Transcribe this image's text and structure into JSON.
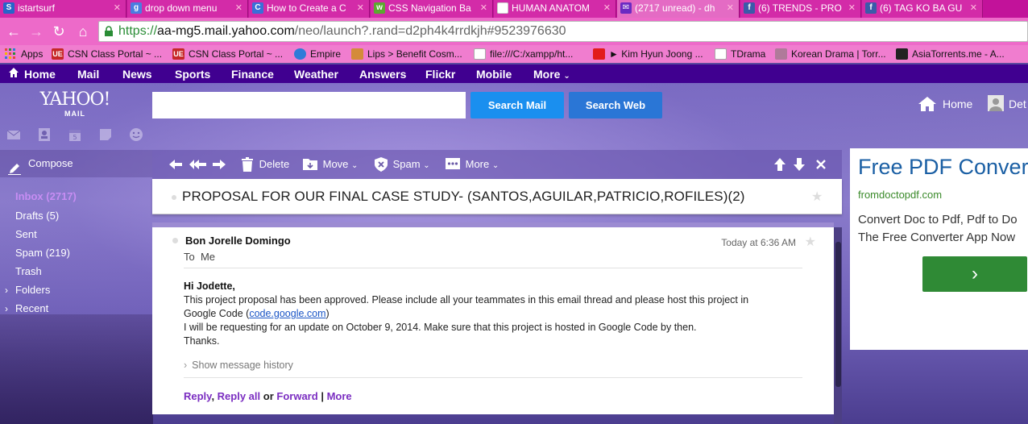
{
  "browser": {
    "tabs": [
      {
        "label": "istartsurf",
        "favicon": "S",
        "color": "#2766c9"
      },
      {
        "label": "drop down menu",
        "favicon": "g",
        "color": "#4a7de0"
      },
      {
        "label": "How to Create a C",
        "favicon": "C",
        "color": "#3a6fd8"
      },
      {
        "label": "CSS Navigation Ba",
        "favicon": "w",
        "color": "#5ca830"
      },
      {
        "label": "HUMAN ANATOM",
        "favicon": "",
        "color": "#ffffff"
      },
      {
        "label": "(2717 unread) - dh",
        "favicon": "",
        "color": "#6b2ac2"
      },
      {
        "label": "(6) TRENDS - PRO",
        "favicon": "f",
        "color": "#3b5ba9"
      },
      {
        "label": "(6) TAG KO BA GU",
        "favicon": "f",
        "color": "#3b5ba9"
      }
    ],
    "url": {
      "scheme": "https://",
      "host": "aa-mg5.mail.yahoo.com",
      "path": "/neo/launch?.rand=d2ph4k4rrdkjh#9523976630"
    },
    "bookmarks": [
      {
        "label": "Apps",
        "color": "#e04a3a"
      },
      {
        "label": "CSN Class Portal ~ ...",
        "color": "#c62828"
      },
      {
        "label": "CSN Class Portal ~ ...",
        "color": "#c62828"
      },
      {
        "label": "Empire",
        "color": "#2f7bd8"
      },
      {
        "label": "Lips > Benefit Cosm...",
        "color": "#d48b3a"
      },
      {
        "label": "file:///C:/xampp/ht...",
        "color": "#ffffff"
      },
      {
        "label": "► Kim Hyun Joong ...",
        "color": "#e21b1b"
      },
      {
        "label": "TDrama",
        "color": "#ffffff"
      },
      {
        "label": "Korean Drama | Torr...",
        "color": "#b07a9a"
      },
      {
        "label": "AsiaTorrents.me - A...",
        "color": "#222222"
      }
    ]
  },
  "ynav": {
    "items": [
      "Home",
      "Mail",
      "News",
      "Sports",
      "Finance",
      "Weather",
      "Answers",
      "Flickr",
      "Mobile",
      "More"
    ]
  },
  "header": {
    "logo_main": "YAHOO!",
    "logo_sub": "MAIL",
    "search_placeholder": "",
    "search_mail": "Search Mail",
    "search_web": "Search Web",
    "home_link": "Home",
    "user_name": "Det"
  },
  "sidebar": {
    "compose": "Compose",
    "folders": [
      {
        "label": "Inbox (2717)",
        "selected": true
      },
      {
        "label": "Drafts (5)"
      },
      {
        "label": "Sent"
      },
      {
        "label": "Spam (219)"
      },
      {
        "label": "Trash"
      },
      {
        "label": "Folders",
        "expandable": true
      },
      {
        "label": "Recent",
        "expandable": true
      }
    ]
  },
  "toolbar": {
    "delete": "Delete",
    "move": "Move",
    "spam": "Spam",
    "more": "More"
  },
  "message": {
    "subject": "PROPOSAL FOR OUR FINAL CASE STUDY- (SANTOS,AGUILAR,PATRICIO,ROFILES)(2)",
    "from": "Bon Jorelle Domingo",
    "to_label": "To",
    "to": "Me",
    "date": "Today at 6:36 AM",
    "greeting": "Hi Jodette,",
    "line1": "This project proposal has been approved. Please include all your teammates in this email thread and please host this project in",
    "line2_pre": "Google Code (",
    "line2_link": "code.google.com",
    "line2_post": ")",
    "line3": "I will be requesting for an update on October 9, 2014. Make sure that this project is hosted in Google Code by then.",
    "line4": "Thanks.",
    "show_history": "Show message history",
    "actions": {
      "reply": "Reply",
      "reply_all": "Reply all",
      "or": "or",
      "forward": "Forward",
      "sep": "|",
      "more": "More"
    }
  },
  "ad": {
    "title": "Free PDF Conver",
    "domain": "fromdoctopdf.com",
    "desc1": "Convert Doc to Pdf, Pdf to Do",
    "desc2": "The Free Converter App Now",
    "button": "›"
  },
  "colors": {
    "tabbar": "#c2129a",
    "ynav": "#400090",
    "search_mail": "#1a8fef",
    "folder_selected": "#c78df3",
    "reply_link": "#7b2ec1",
    "ad_title": "#1a5fa4",
    "ad_button": "#2f8a35"
  }
}
